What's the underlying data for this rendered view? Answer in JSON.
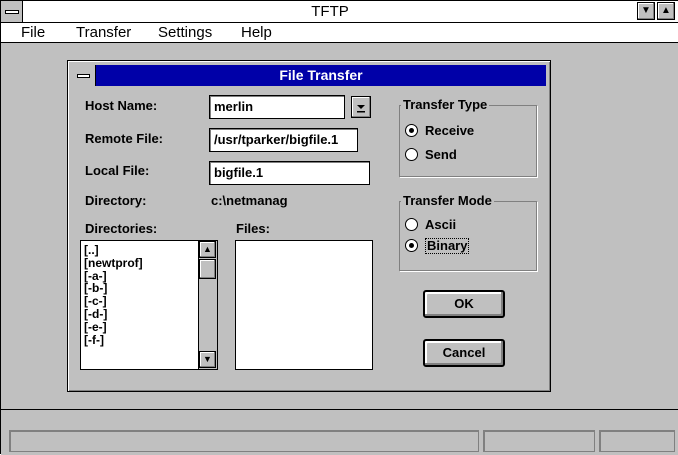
{
  "window": {
    "title": "TFTP"
  },
  "menubar": {
    "items": [
      {
        "label": "File"
      },
      {
        "label": "Transfer"
      },
      {
        "label": "Settings"
      },
      {
        "label": "Help"
      }
    ]
  },
  "dialog": {
    "title": "File Transfer",
    "host_name": {
      "label": "Host Name:",
      "value": "merlin"
    },
    "remote_file": {
      "label": "Remote File:",
      "value": "/usr/tparker/bigfile.1"
    },
    "local_file": {
      "label": "Local File:",
      "value": "bigfile.1"
    },
    "directory": {
      "label": "Directory:",
      "value": "c:\\netmanag"
    },
    "directories": {
      "label": "Directories:",
      "items": [
        "[..]",
        "[newtprof]",
        "[-a-]",
        "[-b-]",
        "[-c-]",
        "[-d-]",
        "[-e-]",
        "[-f-]"
      ]
    },
    "files": {
      "label": "Files:",
      "items": []
    },
    "transfer_type": {
      "label": "Transfer Type",
      "options": [
        {
          "label": "Receive",
          "selected": true
        },
        {
          "label": "Send",
          "selected": false
        }
      ]
    },
    "transfer_mode": {
      "label": "Transfer Mode",
      "options": [
        {
          "label": "Ascii",
          "selected": false
        },
        {
          "label": "Binary",
          "selected": true
        }
      ]
    },
    "ok_label": "OK",
    "cancel_label": "Cancel"
  },
  "icons": {
    "system_menu": "system-menu-icon",
    "minimize": "minimize-arrow-icon",
    "maximize": "maximize-arrow-icon",
    "dropdown": "dropdown-arrow-icon",
    "scroll_up": "scroll-up-arrow-icon",
    "scroll_down": "scroll-down-arrow-icon"
  },
  "colors": {
    "dialog_title_bg": "#0000a8",
    "face": "#c0c0c0"
  }
}
